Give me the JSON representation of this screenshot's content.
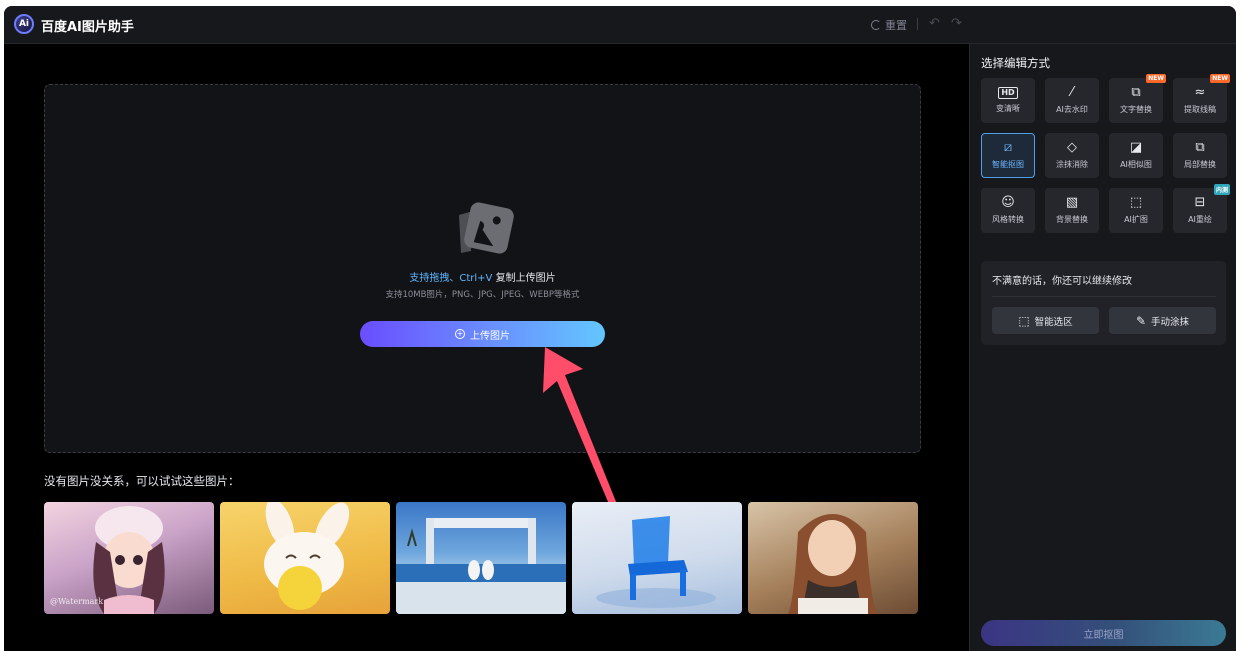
{
  "header": {
    "logo_text": "Ai",
    "title": "百度AI图片助手",
    "reset_label": "重置",
    "undo_icon": "undo-icon",
    "redo_icon": "redo-icon"
  },
  "upload": {
    "hint_highlight": "支持拖拽、Ctrl+V",
    "hint_rest": " 复制上传图片",
    "formats": "支持10MB图片，PNG、JPG、JPEG、WEBP等格式",
    "button_label": "上传图片"
  },
  "samples": {
    "title": "没有图片没关系，可以试试这些图片：",
    "watermark": "@Watermark"
  },
  "panel": {
    "title": "选择编辑方式",
    "tools": [
      {
        "label": "变清晰",
        "icon": "hd-icon",
        "glyph": "HD",
        "badge": ""
      },
      {
        "label": "AI去水印",
        "icon": "magic-wand-icon",
        "glyph": "⁄",
        "badge": ""
      },
      {
        "label": "文字替换",
        "icon": "text-replace-icon",
        "glyph": "T",
        "badge": "NEW"
      },
      {
        "label": "提取线稿",
        "icon": "line-art-icon",
        "glyph": "≈",
        "badge": "NEW"
      },
      {
        "label": "智能抠图",
        "icon": "smart-cutout-icon",
        "glyph": "⧄",
        "badge": ""
      },
      {
        "label": "涂抹消除",
        "icon": "eraser-icon",
        "glyph": "◇",
        "badge": ""
      },
      {
        "label": "AI相似图",
        "icon": "similar-image-icon",
        "glyph": "◪",
        "badge": ""
      },
      {
        "label": "局部替换",
        "icon": "partial-replace-icon",
        "glyph": "⧉",
        "badge": ""
      },
      {
        "label": "风格转换",
        "icon": "style-transfer-icon",
        "glyph": "☺",
        "badge": ""
      },
      {
        "label": "背景替换",
        "icon": "background-replace-icon",
        "glyph": "▧",
        "badge": ""
      },
      {
        "label": "AI扩图",
        "icon": "expand-image-icon",
        "glyph": "⬚",
        "badge": ""
      },
      {
        "label": "AI重绘",
        "icon": "redraw-icon",
        "glyph": "⊟",
        "badge": "内测"
      }
    ],
    "active_tool": "智能抠图",
    "modify_title": "不满意的话，你还可以继续修改",
    "smart_select_label": "智能选区",
    "manual_paint_label": "手动涂抹",
    "cutout_button": "立即抠图"
  },
  "colors": {
    "accent_blue": "#5fb6ff",
    "upload_gradient_start": "#6a4dff",
    "upload_gradient_end": "#63c6ff",
    "arrow_red": "#ff4d6a",
    "badge_new": "#ff6a2b",
    "badge_beta": "#2fa7b8"
  }
}
